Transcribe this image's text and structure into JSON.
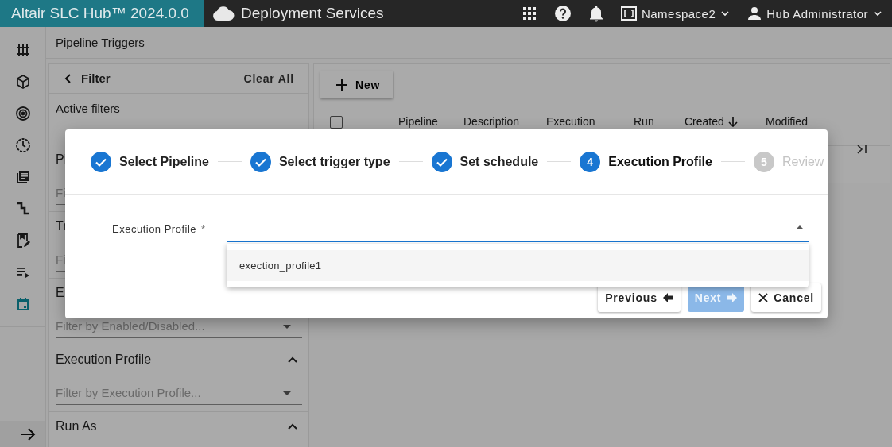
{
  "header": {
    "app_title": "Altair SLC Hub™ 2024.0.0",
    "service": "Deployment Services",
    "namespace": "Namespace2",
    "user": "Hub Administrator"
  },
  "nav_rail": [
    {
      "kind": "hub",
      "selected": false
    },
    {
      "kind": "package",
      "selected": false
    },
    {
      "kind": "target",
      "selected": false
    },
    {
      "kind": "history",
      "selected": false
    },
    {
      "kind": "library",
      "selected": false
    },
    {
      "kind": "flow",
      "selected": false
    },
    {
      "kind": "edit",
      "selected": false
    },
    {
      "kind": "queue",
      "selected": false
    },
    {
      "kind": "calendar",
      "selected": true
    }
  ],
  "breadcrumb": "Pipeline Triggers",
  "filter_panel": {
    "title": "Filter",
    "clear_label": "Clear All",
    "active_filters_label": "Active filters",
    "sections": [
      {
        "title": "Pi",
        "placeholder": "Fi"
      },
      {
        "title": "Tr",
        "placeholder": "Fi"
      },
      {
        "title": "E",
        "placeholder": "Filter by Enabled/Disabled..."
      },
      {
        "title": "Execution Profile",
        "placeholder": "Filter by Execution Profile...",
        "expanded": true
      },
      {
        "title": "Run As",
        "expanded": true
      }
    ]
  },
  "toolbar": {
    "new_label": "New"
  },
  "table": {
    "select_all_checked": false,
    "columns": [
      {
        "label": "Pipeline",
        "sorted": false
      },
      {
        "label": "Description",
        "sorted": false
      },
      {
        "label": "Execution",
        "sorted": false
      },
      {
        "label": "Run",
        "sorted": false
      },
      {
        "label": "Created",
        "sorted": true
      },
      {
        "label": "Modified",
        "sorted": false
      }
    ]
  },
  "dialog": {
    "steps": [
      {
        "label": "Select Pipeline",
        "completed": true,
        "active": false
      },
      {
        "label": "Select trigger type",
        "completed": true,
        "active": false
      },
      {
        "label": "Set schedule",
        "completed": true,
        "active": false
      },
      {
        "label": "Execution Profile",
        "number": "4",
        "completed": false,
        "active": true
      },
      {
        "label": "Review",
        "number": "5",
        "completed": false,
        "active": false
      }
    ],
    "field": {
      "label": "Execution Profile",
      "required_mark": "*",
      "expanded": true
    },
    "options": [
      {
        "label": "exection_profile1",
        "highlighted": true
      }
    ],
    "buttons": [
      {
        "label": "Previous",
        "kind": "previous",
        "disabled": false
      },
      {
        "label": "Next",
        "kind": "next",
        "disabled": true
      },
      {
        "label": "Cancel",
        "kind": "cancel",
        "disabled": false
      }
    ]
  }
}
